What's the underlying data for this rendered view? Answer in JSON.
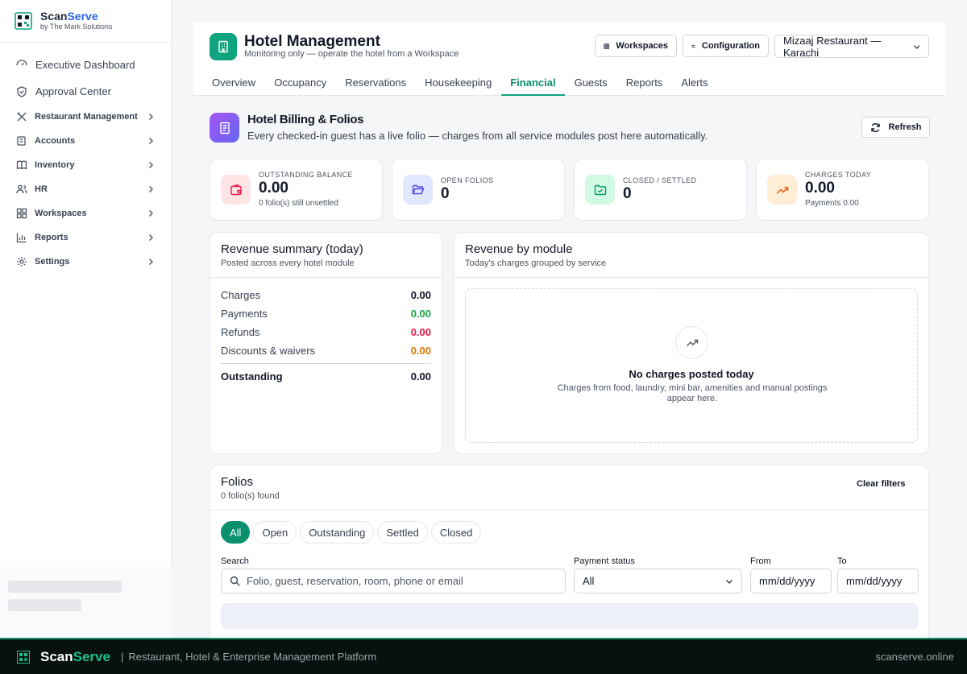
{
  "brand": {
    "name_a": "Scan",
    "name_b": "Serve",
    "sub": "by The Mark Solutions"
  },
  "sidebar": {
    "items": [
      {
        "label": "Executive Dashboard",
        "icon": "pulse-icon"
      },
      {
        "label": "Approval Center",
        "icon": "shield-check-icon"
      },
      {
        "label": "Restaurant Management",
        "icon": "utensils-icon"
      },
      {
        "label": "Accounts",
        "icon": "receipt-icon"
      },
      {
        "label": "Inventory",
        "icon": "book-icon"
      },
      {
        "label": "HR",
        "icon": "users-icon"
      },
      {
        "label": "Workspaces",
        "icon": "grid-icon"
      },
      {
        "label": "Reports",
        "icon": "bar-chart-icon"
      },
      {
        "label": "Settings",
        "icon": "gear-icon"
      }
    ]
  },
  "header": {
    "title": "Hotel Management",
    "subtitle": "Monitoring only — operate the hotel from a Workspace",
    "workspaces_label": "Workspaces",
    "configuration_label": "Configuration",
    "outlet": "Mizaaj Restaurant — Karachi"
  },
  "tabs": [
    "Overview",
    "Occupancy",
    "Reservations",
    "Housekeeping",
    "Financial",
    "Guests",
    "Reports",
    "Alerts"
  ],
  "active_tab": "Financial",
  "section": {
    "title": "Hotel Billing & Folios",
    "subtitle": "Every checked-in guest has a live folio — charges from all service modules post here automatically.",
    "refresh_label": "Refresh"
  },
  "kpis": [
    {
      "label": "Outstanding balance",
      "value": "0.00",
      "note": "0 folio(s) still unsettled",
      "color": "#e11d48"
    },
    {
      "label": "Open folios",
      "value": "0",
      "note": "",
      "color": "#4f46e5"
    },
    {
      "label": "Closed / settled",
      "value": "0",
      "note": "",
      "color": "#059669"
    },
    {
      "label": "Charges today",
      "value": "0.00",
      "note": "Payments 0.00",
      "color": "#ea580c"
    }
  ],
  "revenue_summary": {
    "title": "Revenue summary (today)",
    "subtitle": "Posted across every hotel module",
    "rows": [
      {
        "label": "Charges",
        "value": "0.00",
        "color": "#111827"
      },
      {
        "label": "Payments",
        "value": "0.00",
        "color": "#16a34a"
      },
      {
        "label": "Refunds",
        "value": "0.00",
        "color": "#e11d48"
      },
      {
        "label": "Discounts & waivers",
        "value": "0.00",
        "color": "#d97706"
      }
    ],
    "outstanding_label": "Outstanding",
    "outstanding_value": "0.00"
  },
  "revenue_by_module": {
    "title": "Revenue by module",
    "subtitle": "Today's charges grouped by service",
    "empty_title": "No charges posted today",
    "empty_sub": "Charges from food, laundry, mini bar, amenities and manual postings appear here."
  },
  "folios": {
    "title": "Folios",
    "count": "0 folio(s) found",
    "clear_label": "Clear filters",
    "chips": [
      "All",
      "Open",
      "Outstanding",
      "Settled",
      "Closed"
    ],
    "active_chip": "All",
    "search_label": "Search",
    "search_placeholder": "Folio, guest, reservation, room, phone or email",
    "payment_label": "Payment status",
    "payment_value": "All",
    "from_label": "From",
    "from_placeholder": "mm/dd/yyyy",
    "to_label": "To",
    "to_placeholder": "mm/dd/yyyy"
  },
  "footer": {
    "name_a": "Scan",
    "name_b": "Serve",
    "separator": "|",
    "tagline": "Restaurant, Hotel & Enterprise Management Platform",
    "url": "scanserve.online"
  },
  "colors": {
    "accent": "#0fa37f",
    "brand_blue": "#2563eb"
  }
}
